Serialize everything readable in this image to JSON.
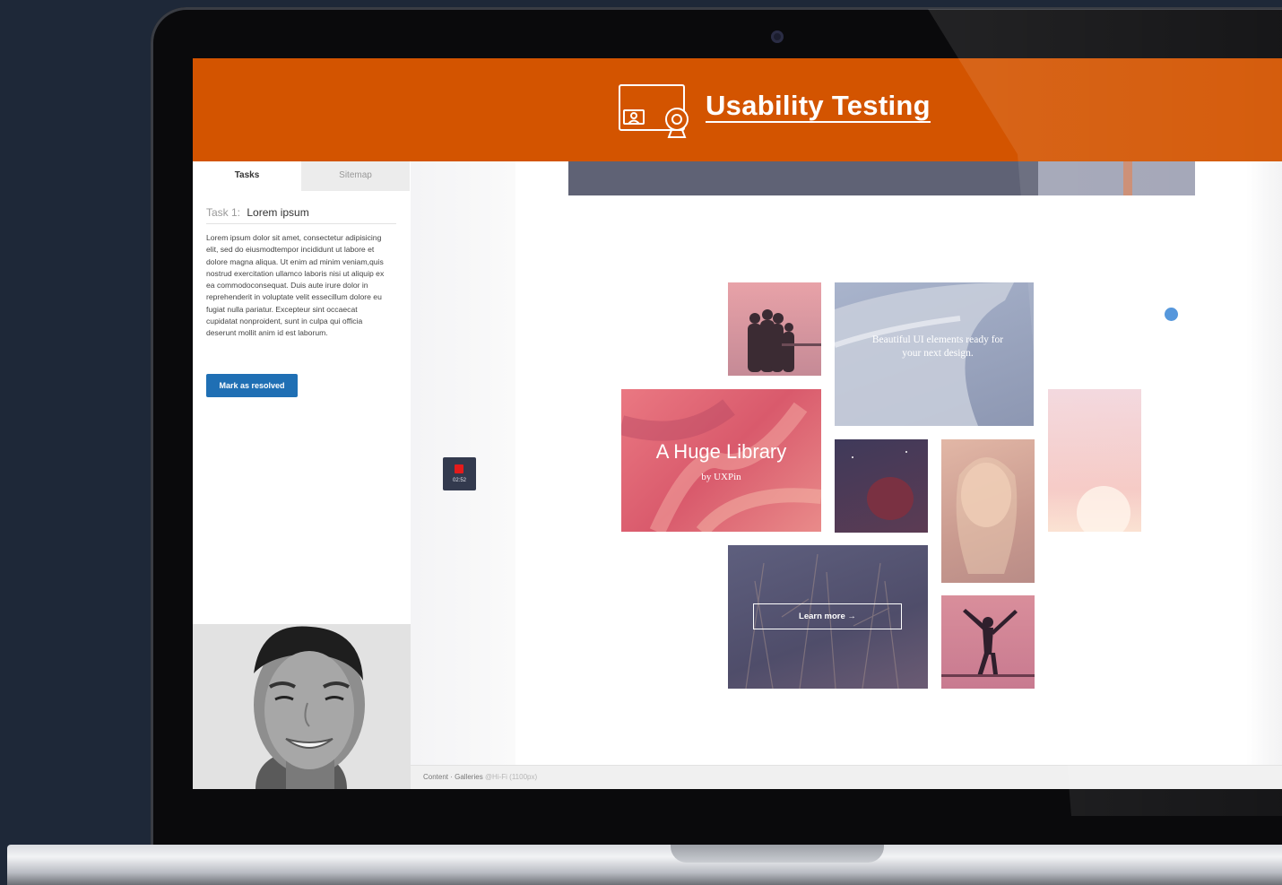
{
  "header": {
    "title": "Usability Testing",
    "icon": "screen-webcam-icon",
    "color": "#d35400"
  },
  "tabs": [
    {
      "label": "Tasks",
      "active": true
    },
    {
      "label": "Sitemap",
      "active": false
    }
  ],
  "task": {
    "number_label": "Task 1:",
    "title": "Lorem ipsum",
    "body": "Lorem ipsum dolor sit amet, consectetur adipisicing elit, sed do eiusmodtempor incididunt ut labore et dolore magna aliqua. Ut enim ad minim veniam,quis nostrud exercitation ullamco laboris nisi ut aliquip ex ea commodoconsequat. Duis aute irure dolor in reprehenderit in voluptate velit essecillum dolore eu fugiat nulla pariatur. Excepteur sint occaecat cupidatat nonproident, sunt in culpa qui officia deserunt mollit anim id est laborum.",
    "resolve_label": "Mark as resolved"
  },
  "recorder": {
    "time": "02:52",
    "indicator_color": "#e41b1b"
  },
  "gallery": {
    "tile_caption": "Beautiful UI elements ready for your next design.",
    "library_title": "A Huge Library",
    "library_subtitle": "by UXPin",
    "learn_more_label": "Learn more →"
  },
  "statusbar": {
    "path": "Content · Galleries",
    "detail": "@Hi-Fi (1100px)"
  },
  "colors": {
    "accent": "#d35400",
    "button": "#1f6fb4",
    "indicator": "#4a90d9"
  }
}
